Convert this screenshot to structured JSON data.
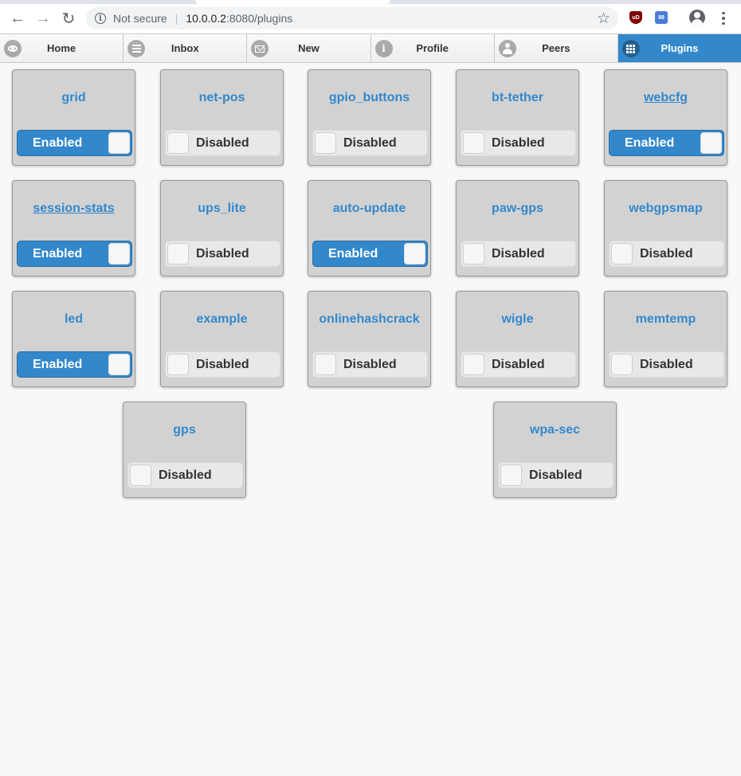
{
  "browser": {
    "security_label": "Not secure",
    "url_host": "10.0.0.2",
    "url_path": ":8080/plugins",
    "ext_ublock_label": "uD",
    "ext_other_label": "88"
  },
  "navbar": {
    "items": [
      {
        "label": "Home",
        "icon": "eye-icon",
        "active": false
      },
      {
        "label": "Inbox",
        "icon": "list-icon",
        "active": false
      },
      {
        "label": "New",
        "icon": "mail-icon",
        "active": false
      },
      {
        "label": "Profile",
        "icon": "info-icon",
        "active": false
      },
      {
        "label": "Peers",
        "icon": "user-icon",
        "active": false
      },
      {
        "label": "Plugins",
        "icon": "grid-icon",
        "active": true
      }
    ]
  },
  "plugins": [
    {
      "name": "grid",
      "state": "Enabled",
      "enabled": true,
      "underlined": false
    },
    {
      "name": "net-pos",
      "state": "Disabled",
      "enabled": false,
      "underlined": false
    },
    {
      "name": "gpio_buttons",
      "state": "Disabled",
      "enabled": false,
      "underlined": false
    },
    {
      "name": "bt-tether",
      "state": "Disabled",
      "enabled": false,
      "underlined": false
    },
    {
      "name": "webcfg",
      "state": "Enabled",
      "enabled": true,
      "underlined": true
    },
    {
      "name": "session-stats",
      "state": "Enabled",
      "enabled": true,
      "underlined": true
    },
    {
      "name": "ups_lite",
      "state": "Disabled",
      "enabled": false,
      "underlined": false
    },
    {
      "name": "auto-update",
      "state": "Enabled",
      "enabled": true,
      "underlined": false
    },
    {
      "name": "paw-gps",
      "state": "Disabled",
      "enabled": false,
      "underlined": false
    },
    {
      "name": "webgpsmap",
      "state": "Disabled",
      "enabled": false,
      "underlined": false
    },
    {
      "name": "led",
      "state": "Enabled",
      "enabled": true,
      "underlined": false
    },
    {
      "name": "example",
      "state": "Disabled",
      "enabled": false,
      "underlined": false
    },
    {
      "name": "onlinehashcrack",
      "state": "Disabled",
      "enabled": false,
      "underlined": false
    },
    {
      "name": "wigle",
      "state": "Disabled",
      "enabled": false,
      "underlined": false
    },
    {
      "name": "memtemp",
      "state": "Disabled",
      "enabled": false,
      "underlined": false
    },
    {
      "name": "gps",
      "state": "Disabled",
      "enabled": false,
      "underlined": false
    },
    {
      "name": "wpa-sec",
      "state": "Disabled",
      "enabled": false,
      "underlined": false
    }
  ],
  "colors": {
    "accent": "#3388cc",
    "card_bg": "#d2d2d2",
    "page_bg": "#f8f8f8"
  }
}
